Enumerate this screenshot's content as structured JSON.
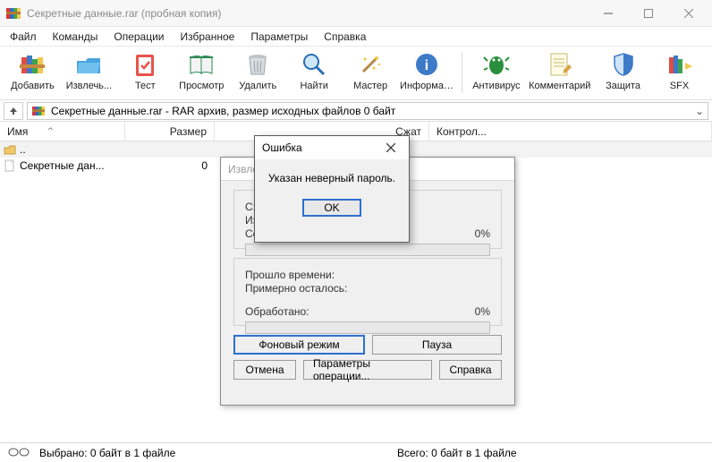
{
  "title": "Секретные данные.rar (пробная копия)",
  "menu": [
    "Файл",
    "Команды",
    "Операции",
    "Избранное",
    "Параметры",
    "Справка"
  ],
  "toolbar": {
    "add": "Добавить",
    "extract": "Извлечь...",
    "test": "Тест",
    "view": "Просмотр",
    "delete": "Удалить",
    "find": "Найти",
    "wizard": "Мастер",
    "info": "Информация",
    "antivirus": "Антивирус",
    "comment": "Комментарий",
    "protect": "Защита",
    "sfx": "SFX"
  },
  "address": "Секретные данные.rar - RAR архив, размер исходных файлов 0 байт",
  "columns": {
    "name": "Имя",
    "size": "Размер",
    "packed": "Сжат",
    "crc": "Контрол..."
  },
  "rows": {
    "up": "..",
    "file": "Секретные дан...",
    "file_size": "0"
  },
  "status": {
    "sel": "Выбрано: 0 байт в 1 файле",
    "total": "Всего: 0 байт в 1 файле"
  },
  "progress": {
    "title": "Извле",
    "path": "C:\\U                                                 е данные.rar",
    "line2": "Изв",
    "line3": "Сек",
    "pct1": "0%",
    "elapsed": "Прошло времени:",
    "remaining": "Примерно осталось:",
    "processed": "Обработано:",
    "pct2": "0%",
    "bg": "Фоновый режим",
    "pause": "Пауза",
    "cancel": "Отмена",
    "params": "Параметры операции...",
    "help": "Справка"
  },
  "error": {
    "title": "Ошибка",
    "message": "Указан неверный пароль.",
    "ok": "OK"
  }
}
